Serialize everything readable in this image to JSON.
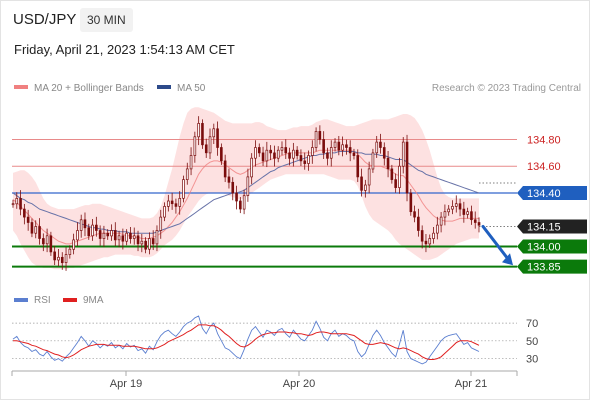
{
  "header": {
    "symbol": "USD/JPY",
    "timeframe": "30 MIN",
    "datetime": "Friday, April 21, 2023 1:54:13 AM CET"
  },
  "legend": {
    "ma20_label": "MA 20 + Bollinger Bands",
    "ma50_label": "MA 50",
    "research": "Research © 2023 Trading Central",
    "rsi_label": "RSI",
    "rsi_ma_label": "9MA"
  },
  "colors": {
    "candle": "#7a0d0d",
    "bollinger_fill": "#fddcdc",
    "ma20": "#f08080",
    "ma50": "#6873a8",
    "resistance": "#e88a8a",
    "resistance_label": "#cc2222",
    "pivot": "#3366cc",
    "pivot_label_bg": "#1f5fbf",
    "support": "#0b7a0b",
    "support_label_bg": "#0b7a0b",
    "last_price_bg": "#222222",
    "arrow": "#1f5fbf",
    "rsi_line": "#5b7fd0",
    "rsi_ma": "#e02020"
  },
  "chart_data": [
    {
      "type": "candlestick",
      "title": "USD/JPY",
      "timeframe": "30 MIN",
      "x_ticks": [
        "Apr 19",
        "Apr 20",
        "Apr 21"
      ],
      "ylim": [
        133.78,
        135.05
      ],
      "levels": [
        {
          "value": 134.8,
          "label": "134.80",
          "kind": "resistance"
        },
        {
          "value": 134.6,
          "label": "134.60",
          "kind": "resistance"
        },
        {
          "value": 134.4,
          "label": "134.40",
          "kind": "pivot"
        },
        {
          "value": 134.0,
          "label": "134.00",
          "kind": "support"
        },
        {
          "value": 133.85,
          "label": "133.85",
          "kind": "support"
        }
      ],
      "last_price": {
        "value": 134.15,
        "label": "134.15"
      },
      "forecast_arrow": {
        "from": 134.15,
        "to": 133.86
      },
      "closes": [
        134.32,
        134.36,
        134.28,
        134.22,
        134.18,
        134.1,
        134.15,
        134.06,
        134.02,
        134.08,
        133.96,
        133.9,
        133.92,
        133.88,
        133.94,
        133.98,
        134.05,
        134.12,
        134.2,
        134.14,
        134.08,
        134.16,
        134.12,
        134.06,
        134.1,
        134.08,
        134.12,
        134.05,
        134.08,
        134.04,
        134.1,
        134.06,
        134.08,
        134.02,
        134.04,
        133.98,
        134.06,
        134.02,
        134.12,
        134.22,
        134.3,
        134.34,
        134.32,
        134.3,
        134.36,
        134.5,
        134.58,
        134.68,
        134.82,
        134.92,
        134.76,
        134.7,
        134.82,
        134.88,
        134.74,
        134.64,
        134.52,
        134.48,
        134.4,
        134.34,
        134.28,
        134.38,
        134.52,
        134.66,
        134.74,
        134.7,
        134.64,
        134.72,
        134.7,
        134.66,
        134.72,
        134.74,
        134.7,
        134.66,
        134.72,
        134.68,
        134.64,
        134.62,
        134.68,
        134.74,
        134.86,
        134.8,
        134.7,
        134.66,
        134.74,
        134.78,
        134.72,
        134.76,
        134.74,
        134.7,
        134.68,
        134.52,
        134.42,
        134.46,
        134.58,
        134.7,
        134.78,
        134.74,
        134.66,
        134.58,
        134.5,
        134.44,
        134.6,
        134.78,
        134.4,
        134.26,
        134.22,
        134.12,
        134.04,
        134.02,
        134.06,
        134.1,
        134.16,
        134.22,
        134.26,
        134.28,
        134.3,
        134.32,
        134.28,
        134.24,
        134.26,
        134.2,
        134.18,
        134.16
      ],
      "ma20": [
        134.35,
        134.33,
        134.3,
        134.27,
        134.24,
        134.21,
        134.18,
        134.15,
        134.12,
        134.1,
        134.08,
        134.06,
        134.04,
        134.03,
        134.02,
        134.02,
        134.03,
        134.04,
        134.05,
        134.06,
        134.07,
        134.08,
        134.09,
        134.1,
        134.1,
        134.1,
        134.1,
        134.1,
        134.1,
        134.09,
        134.08,
        134.08,
        134.07,
        134.07,
        134.06,
        134.06,
        134.06,
        134.07,
        134.08,
        134.1,
        134.12,
        134.15,
        134.18,
        134.22,
        134.26,
        134.31,
        134.36,
        134.42,
        134.48,
        134.54,
        134.58,
        134.61,
        134.63,
        134.64,
        134.64,
        134.63,
        134.61,
        134.59,
        134.57,
        134.55,
        134.54,
        134.55,
        134.57,
        134.59,
        134.61,
        134.62,
        134.63,
        134.64,
        134.65,
        134.66,
        134.67,
        134.68,
        134.69,
        134.7,
        134.7,
        134.7,
        134.7,
        134.7,
        134.7,
        134.7,
        134.71,
        134.72,
        134.72,
        134.72,
        134.72,
        134.72,
        134.72,
        134.72,
        134.72,
        134.72,
        134.71,
        134.69,
        134.66,
        134.63,
        134.61,
        134.6,
        134.6,
        134.6,
        134.59,
        134.58,
        134.56,
        134.54,
        134.53,
        134.53,
        134.5,
        134.46,
        134.42,
        134.38,
        134.33,
        134.29,
        134.26,
        134.23,
        134.21,
        134.2,
        134.19,
        134.19,
        134.19,
        134.2,
        134.21,
        134.21,
        134.21,
        134.21,
        134.21,
        134.21
      ],
      "ma50": [
        134.4,
        134.38,
        134.36,
        134.35,
        134.33,
        134.32,
        134.3,
        134.28,
        134.27,
        134.26,
        134.25,
        134.24,
        134.23,
        134.22,
        134.21,
        134.2,
        134.19,
        134.18,
        134.17,
        134.16,
        134.15,
        134.14,
        134.14,
        134.13,
        134.13,
        134.12,
        134.12,
        134.12,
        134.11,
        134.11,
        134.11,
        134.1,
        134.1,
        134.1,
        134.1,
        134.1,
        134.1,
        134.1,
        134.11,
        134.12,
        134.13,
        134.14,
        134.15,
        134.16,
        134.17,
        134.19,
        134.21,
        134.23,
        134.25,
        134.27,
        134.29,
        134.31,
        134.33,
        134.35,
        134.36,
        134.37,
        134.38,
        134.39,
        134.4,
        134.4,
        134.41,
        134.42,
        134.44,
        134.46,
        134.48,
        134.5,
        134.52,
        134.54,
        134.56,
        134.57,
        134.59,
        134.6,
        134.61,
        134.62,
        134.63,
        134.64,
        134.65,
        134.66,
        134.67,
        134.68,
        134.68,
        134.69,
        134.69,
        134.7,
        134.7,
        134.7,
        134.71,
        134.71,
        134.71,
        134.71,
        134.71,
        134.7,
        134.7,
        134.69,
        134.69,
        134.69,
        134.69,
        134.68,
        134.68,
        134.67,
        134.66,
        134.65,
        134.65,
        134.65,
        134.63,
        134.61,
        134.59,
        134.57,
        134.56,
        134.54,
        134.53,
        134.52,
        134.51,
        134.5,
        134.49,
        134.48,
        134.47,
        134.46,
        134.45,
        134.44,
        134.43,
        134.42,
        134.41,
        134.4
      ],
      "bollinger_upper": [
        134.55,
        134.56,
        134.57,
        134.57,
        134.55,
        134.52,
        134.48,
        134.42,
        134.36,
        134.32,
        134.3,
        134.29,
        134.28,
        134.28,
        134.28,
        134.28,
        134.28,
        134.29,
        134.3,
        134.31,
        134.31,
        134.32,
        134.32,
        134.32,
        134.31,
        134.3,
        134.29,
        134.28,
        134.27,
        134.26,
        134.25,
        134.24,
        134.23,
        134.22,
        134.21,
        134.21,
        134.21,
        134.22,
        134.25,
        134.3,
        134.38,
        134.48,
        134.58,
        134.7,
        134.82,
        134.92,
        135.0,
        135.03,
        135.04,
        135.04,
        135.03,
        135.02,
        135.01,
        135.0,
        134.98,
        134.96,
        134.94,
        134.93,
        134.92,
        134.92,
        134.92,
        134.92,
        134.92,
        134.92,
        134.93,
        134.93,
        134.92,
        134.9,
        134.89,
        134.88,
        134.87,
        134.87,
        134.87,
        134.88,
        134.89,
        134.89,
        134.9,
        134.9,
        134.9,
        134.91,
        134.93,
        134.94,
        134.95,
        134.95,
        134.94,
        134.93,
        134.92,
        134.91,
        134.9,
        134.9,
        134.9,
        134.91,
        134.92,
        134.93,
        134.94,
        134.95,
        134.95,
        134.95,
        134.95,
        134.95,
        134.96,
        134.97,
        134.98,
        134.99,
        134.99,
        134.98,
        134.96,
        134.92,
        134.87,
        134.8,
        134.72,
        134.62,
        134.52,
        134.44,
        134.39,
        134.37,
        134.36,
        134.36,
        134.36,
        134.36,
        134.36,
        134.36,
        134.36,
        134.36
      ],
      "bollinger_lower": [
        134.12,
        134.08,
        134.02,
        133.97,
        133.92,
        133.88,
        133.86,
        133.85,
        133.84,
        133.84,
        133.84,
        133.83,
        133.83,
        133.83,
        133.83,
        133.84,
        133.84,
        133.85,
        133.86,
        133.87,
        133.88,
        133.89,
        133.9,
        133.91,
        133.92,
        133.92,
        133.93,
        133.94,
        133.94,
        133.94,
        133.94,
        133.94,
        133.93,
        133.93,
        133.92,
        133.92,
        133.92,
        133.93,
        133.95,
        133.98,
        134.01,
        134.03,
        134.05,
        134.08,
        134.12,
        134.17,
        134.22,
        134.26,
        134.3,
        134.34,
        134.37,
        134.39,
        134.4,
        134.4,
        134.4,
        134.4,
        134.39,
        134.38,
        134.37,
        134.36,
        134.35,
        134.36,
        134.38,
        134.4,
        134.42,
        134.44,
        134.46,
        134.48,
        134.5,
        134.51,
        134.52,
        134.53,
        134.54,
        134.54,
        134.54,
        134.54,
        134.54,
        134.54,
        134.54,
        134.54,
        134.54,
        134.54,
        134.54,
        134.53,
        134.52,
        134.51,
        134.5,
        134.5,
        134.5,
        134.5,
        134.49,
        134.45,
        134.38,
        134.3,
        134.24,
        134.2,
        134.18,
        134.16,
        134.14,
        134.12,
        134.09,
        134.05,
        134.02,
        134.0,
        133.98,
        133.96,
        133.94,
        133.92,
        133.9,
        133.9,
        133.9,
        133.91,
        133.92,
        133.94,
        133.96,
        133.98,
        134.0,
        134.02,
        134.03,
        134.04,
        134.05,
        134.06,
        134.06,
        134.06
      ]
    },
    {
      "type": "line",
      "title": "RSI",
      "ylim": [
        25,
        78
      ],
      "y_ticks": [
        70,
        50,
        30
      ],
      "series": [
        {
          "name": "RSI",
          "values": [
            52,
            55,
            48,
            44,
            42,
            38,
            40,
            35,
            33,
            38,
            32,
            28,
            30,
            27,
            32,
            36,
            42,
            48,
            55,
            50,
            44,
            50,
            47,
            42,
            46,
            44,
            48,
            42,
            45,
            41,
            47,
            43,
            45,
            39,
            41,
            36,
            44,
            40,
            49,
            56,
            60,
            62,
            58,
            55,
            60,
            66,
            70,
            72,
            76,
            78,
            64,
            58,
            66,
            70,
            58,
            50,
            42,
            40,
            36,
            32,
            30,
            40,
            52,
            62,
            66,
            60,
            54,
            62,
            60,
            56,
            62,
            64,
            58,
            54,
            62,
            57,
            52,
            50,
            56,
            62,
            72,
            64,
            54,
            50,
            58,
            62,
            55,
            58,
            56,
            52,
            50,
            38,
            32,
            36,
            46,
            56,
            62,
            56,
            48,
            42,
            36,
            32,
            46,
            62,
            38,
            30,
            28,
            26,
            24,
            26,
            32,
            38,
            44,
            50,
            54,
            56,
            57,
            58,
            52,
            46,
            48,
            42,
            40,
            38
          ]
        },
        {
          "name": "9MA",
          "values": [
            50,
            50,
            49,
            48,
            47,
            45,
            44,
            42,
            40,
            39,
            37,
            35,
            34,
            32,
            31,
            32,
            34,
            37,
            40,
            42,
            44,
            45,
            46,
            46,
            46,
            45,
            45,
            45,
            45,
            44,
            44,
            44,
            44,
            43,
            42,
            41,
            41,
            41,
            42,
            44,
            46,
            49,
            51,
            53,
            55,
            57,
            60,
            62,
            65,
            68,
            68,
            68,
            67,
            67,
            65,
            62,
            58,
            55,
            51,
            47,
            44,
            43,
            45,
            48,
            52,
            55,
            57,
            58,
            59,
            59,
            60,
            60,
            60,
            59,
            59,
            58,
            58,
            57,
            56,
            57,
            59,
            60,
            60,
            59,
            58,
            58,
            58,
            58,
            58,
            57,
            56,
            53,
            50,
            47,
            46,
            46,
            47,
            48,
            47,
            46,
            44,
            42,
            41,
            42,
            41,
            39,
            37,
            35,
            32,
            30,
            29,
            29,
            30,
            32,
            36,
            40,
            44,
            48,
            50,
            50,
            50,
            49,
            47,
            45
          ]
        }
      ]
    }
  ]
}
